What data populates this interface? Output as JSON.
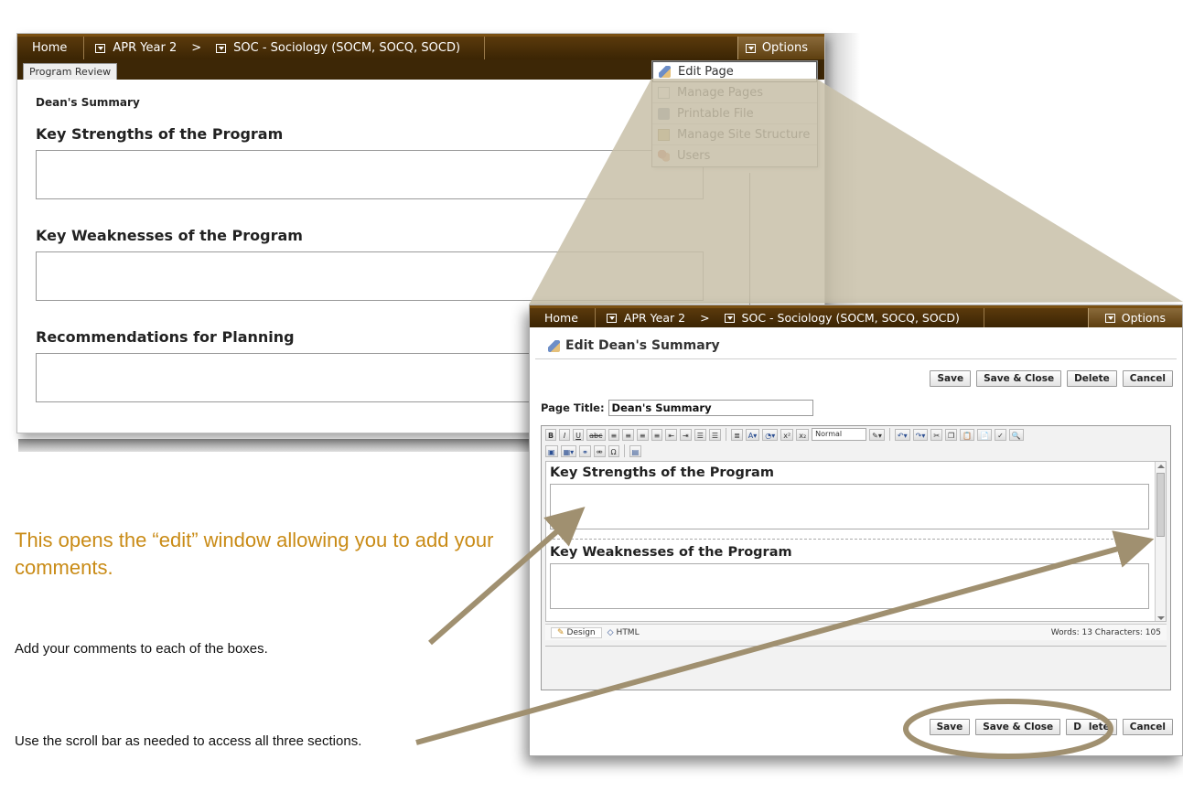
{
  "nav": {
    "home": "Home",
    "crumb1": "APR Year 2",
    "separator": ">",
    "crumb2": "SOC - Sociology (SOCM, SOCQ, SOCD)",
    "options": "Options"
  },
  "background_page": {
    "tab": "Program Review",
    "subtitle": "Dean's Summary",
    "sections": [
      "Key Strengths of the Program",
      "Key Weaknesses of the Program",
      "Recommendations for Planning"
    ]
  },
  "options_menu": {
    "items": [
      {
        "label": "Edit Page",
        "icon": "pencil-icon"
      },
      {
        "label": "Manage Pages",
        "icon": "page-icon"
      },
      {
        "label": "Printable File",
        "icon": "printer-icon"
      },
      {
        "label": "Manage Site Structure",
        "icon": "structure-icon"
      },
      {
        "label": "Users",
        "icon": "users-icon"
      }
    ]
  },
  "edit_window": {
    "title": "Edit Dean's Summary",
    "buttons": {
      "save": "Save",
      "save_close": "Save & Close",
      "delete": "Delete",
      "cancel": "Cancel",
      "delete_partial_d": "D",
      "delete_partial_rest": "lete"
    },
    "page_title_label": "Page Title:",
    "page_title_value": "Dean's Summary",
    "toolbar": {
      "bold": "B",
      "italic": "I",
      "underline": "U",
      "strike": "abc",
      "font_format": "Normal",
      "omega": "Ω"
    },
    "content_sections": [
      "Key Strengths of the Program",
      "Key Weaknesses of the Program"
    ],
    "footer": {
      "design": "Design",
      "html": "HTML",
      "word_count": "Words: 13  Characters: 105"
    }
  },
  "annotations": {
    "heading": "This opens the “edit” window allowing you to add your comments.",
    "instruction1": "Add your comments to each of the boxes.",
    "instruction2": "Use the scroll bar as needed to access all three sections."
  },
  "colors": {
    "nav_brown": "#3b2504",
    "annotation_orange": "#c98b16",
    "arrow_taupe": "#a09070",
    "beam_beige": "#c8bfa8"
  }
}
